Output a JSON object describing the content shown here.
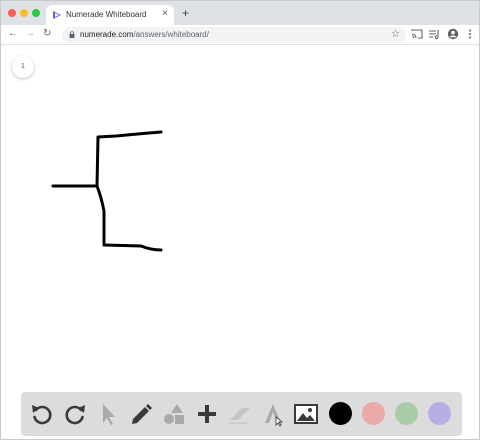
{
  "browser": {
    "tab_title": "Numerade Whiteboard",
    "tab_close": "×",
    "new_tab": "+",
    "url_domain": "numerade.com",
    "url_path": "/answers/whiteboard/"
  },
  "whiteboard": {
    "page_number": "1"
  },
  "tools": {
    "items": [
      "undo-icon",
      "redo-icon",
      "pointer-icon",
      "pencil-icon",
      "shapes-icon",
      "add-icon",
      "eraser-icon",
      "text-icon",
      "image-icon"
    ],
    "colors": [
      "#000000",
      "#eaa8a8",
      "#a8cca8",
      "#b8aee6"
    ]
  }
}
